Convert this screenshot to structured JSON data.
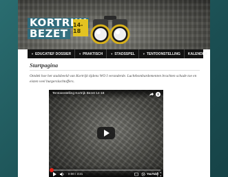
{
  "banner": {
    "logo_line1": "KORTRIJK",
    "logo_line2": "BEZET",
    "logo_badge": "14-18",
    "colors": {
      "logo_bg": "#2a6e82",
      "badge": "#e3c321"
    }
  },
  "nav": {
    "items": [
      {
        "label": "EDUCATIEF DOSSIER",
        "has_arrow": true
      },
      {
        "label": "PRAKTISCH",
        "has_arrow": true
      },
      {
        "label": "STADSSPEL",
        "has_arrow": true
      },
      {
        "label": "TENTOONSTELLING",
        "has_arrow": true
      },
      {
        "label": "KALENDER",
        "has_arrow": false
      }
    ]
  },
  "content": {
    "title": "Startpagina",
    "intro": "Ontdek hoe het stadsbeeld van Kortrijk tijdens WO I veranderde. Luchtbombardementen brachten schade toe en eisten veel burgerslachtoffers."
  },
  "video": {
    "title": "Tentoonstelling Kortrijk Bezet 14-18",
    "time": "0:00 / 3:21",
    "youtube_label": "YouTube",
    "progress": 0.0,
    "icons": [
      "share-icon",
      "info-icon",
      "play-icon",
      "volume-icon",
      "captions-icon",
      "settings-icon",
      "fullscreen-icon"
    ]
  }
}
